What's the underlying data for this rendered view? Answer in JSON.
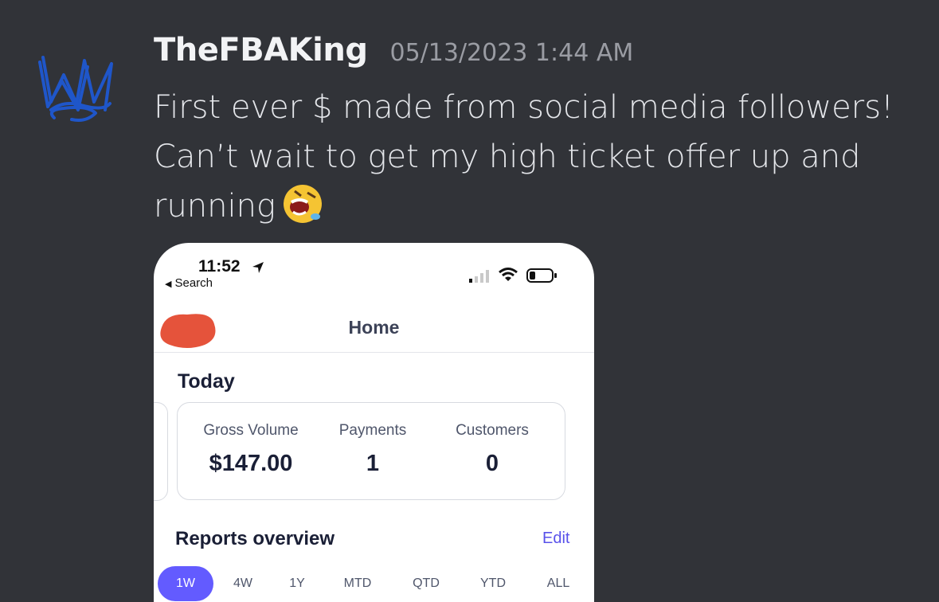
{
  "post": {
    "username": "TheFBAKing",
    "timestamp": "05/13/2023 1:44 AM",
    "message_lines": [
      "First ever $ made from social media followers!",
      "Can’t wait to get my high ticket offer up and",
      "running"
    ],
    "emoji": "laughing-crying-emoji",
    "avatar_icon": "crown-icon"
  },
  "screenshot": {
    "status_bar": {
      "time": "11:52",
      "back_label": "Search"
    },
    "nav_title": "Home",
    "today_heading": "Today",
    "metrics": [
      {
        "label": "Gross Volume",
        "value": "$147.00"
      },
      {
        "label": "Payments",
        "value": "1"
      },
      {
        "label": "Customers",
        "value": "0"
      }
    ],
    "reports_heading": "Reports overview",
    "edit_label": "Edit",
    "ranges": [
      "1W",
      "4W",
      "1Y",
      "MTD",
      "QTD",
      "YTD",
      "ALL"
    ],
    "active_range": "1W"
  },
  "colors": {
    "background": "#313338",
    "username": "#f2f3f5",
    "timestamp": "#9a9ca3",
    "avatar_crown": "#1f56c9",
    "accent_purple": "#635bff",
    "redaction": "#e5533b"
  }
}
